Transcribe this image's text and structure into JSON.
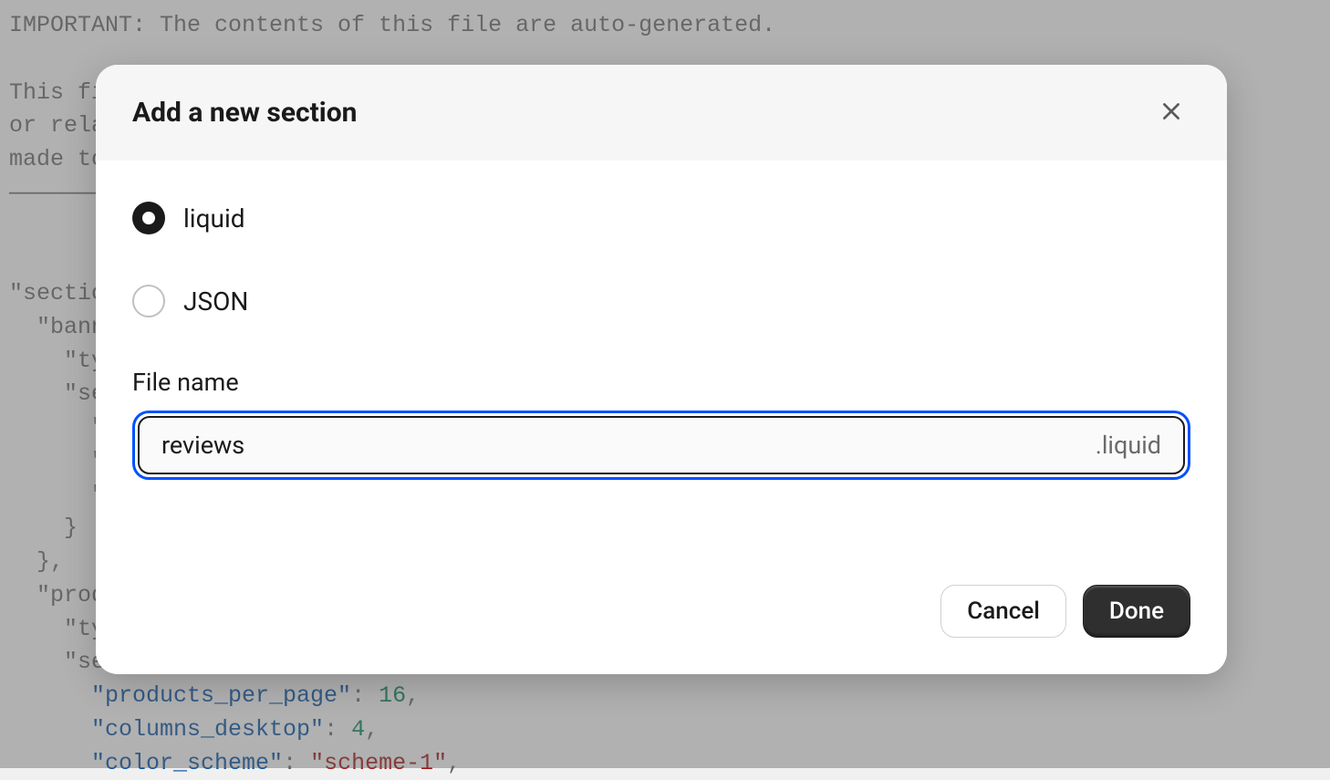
{
  "background_code": {
    "line1": "IMPORTANT: The contents of this file are auto-generated.",
    "line2": "",
    "line3": "This fi",
    "line4": "or rela",
    "line5": "made to",
    "line6": "———————",
    "line7": "",
    "line8": "",
    "line9": "\"sectio",
    "line10": "  \"bann",
    "line11": "    \"ty",
    "line12": "    \"se",
    "line13": "      \"",
    "line14": "      \"",
    "line15": "      \"",
    "line16": "    }",
    "line17": "  },",
    "line18": "  \"prod",
    "line19": "    \"ty",
    "line20": "    \"se",
    "line21_key": "\"products_per_page\"",
    "line21_val": "16",
    "line22_key": "\"columns_desktop\"",
    "line22_val": "4",
    "line23_key": "\"color_scheme\"",
    "line23_val": "\"scheme-1\""
  },
  "modal": {
    "title": "Add a new section",
    "options": {
      "liquid": "liquid",
      "json": "JSON"
    },
    "filename_label": "File name",
    "filename_value": "reviews",
    "file_extension": ".liquid",
    "buttons": {
      "cancel": "Cancel",
      "done": "Done"
    }
  }
}
